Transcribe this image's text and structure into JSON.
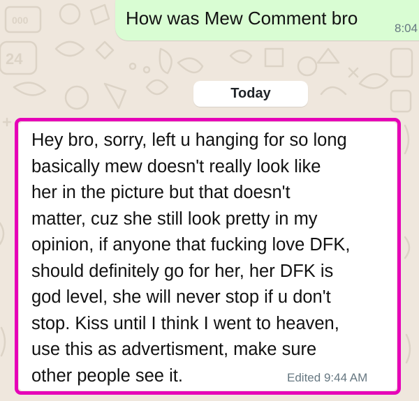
{
  "colors": {
    "wallpaper": "#efe7dd",
    "outgoing_bubble": "#d9fdd3",
    "incoming_bubble": "#ffffff",
    "highlight_border": "#e600b8",
    "timestamp": "#667781"
  },
  "wallpaper": {
    "doodle_text_1": "24",
    "doodle_text_2": "000"
  },
  "messages": [
    {
      "direction": "outgoing",
      "text": "How was Mew Comment bro",
      "time": "8:04"
    },
    {
      "direction": "incoming",
      "text": "Hey bro, sorry, left u hanging for so long\nbasically mew doesn't really look like\nher in the picture but that doesn't\nmatter, cuz she still look pretty in my\nopinion, if anyone that fucking love DFK,\nshould definitely go for her, her DFK is\ngod level, she will never stop if u don't\nstop. Kiss until I think I went to heaven,\nuse this as advertisment, make sure\nother people see it.",
      "edited_label": "Edited",
      "time": "9:44 AM"
    }
  ],
  "date_separator": "Today"
}
